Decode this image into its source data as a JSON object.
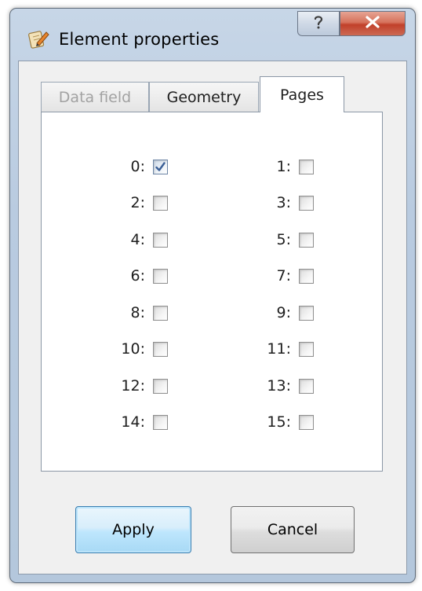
{
  "window": {
    "title": "Element properties",
    "help_label": "?",
    "close_label": "X"
  },
  "tabs": [
    {
      "label": "Data field",
      "state": "disabled"
    },
    {
      "label": "Geometry",
      "state": "inactive"
    },
    {
      "label": "Pages",
      "state": "selected"
    }
  ],
  "pages": [
    {
      "label": "0:",
      "checked": true
    },
    {
      "label": "1:",
      "checked": false
    },
    {
      "label": "2:",
      "checked": false
    },
    {
      "label": "3:",
      "checked": false
    },
    {
      "label": "4:",
      "checked": false
    },
    {
      "label": "5:",
      "checked": false
    },
    {
      "label": "6:",
      "checked": false
    },
    {
      "label": "7:",
      "checked": false
    },
    {
      "label": "8:",
      "checked": false
    },
    {
      "label": "9:",
      "checked": false
    },
    {
      "label": "10:",
      "checked": false
    },
    {
      "label": "11:",
      "checked": false
    },
    {
      "label": "12:",
      "checked": false
    },
    {
      "label": "13:",
      "checked": false
    },
    {
      "label": "14:",
      "checked": false
    },
    {
      "label": "15:",
      "checked": false
    }
  ],
  "buttons": {
    "apply_label": "Apply",
    "cancel_label": "Cancel"
  },
  "icons": {
    "app": "notepad-pencil-icon",
    "help": "question-mark-icon",
    "close": "close-x-icon",
    "check": "checkmark-icon"
  }
}
